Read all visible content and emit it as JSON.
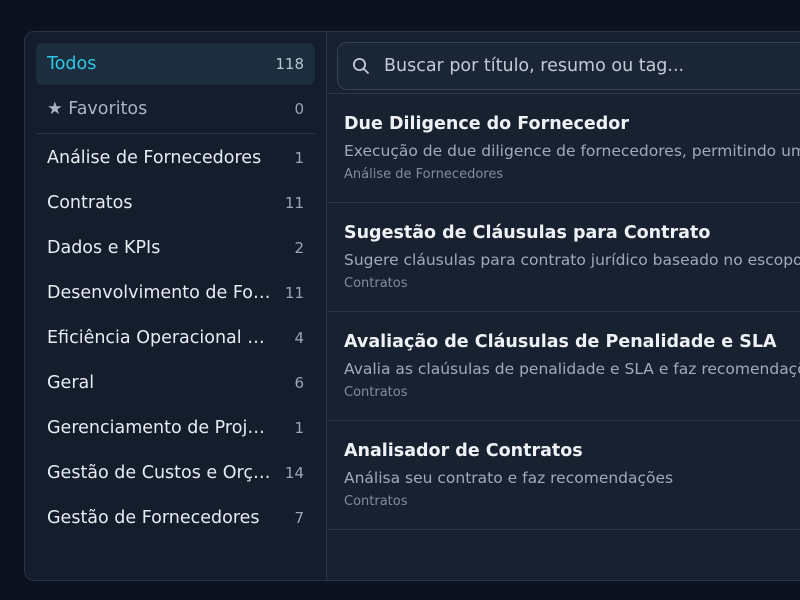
{
  "sidebar": {
    "all": {
      "label": "Todos",
      "count": "118"
    },
    "favorites": {
      "label": "★ Favoritos",
      "count": "0"
    },
    "categories": [
      {
        "label": "Análise de Fornecedores",
        "count": "1"
      },
      {
        "label": "Contratos",
        "count": "11"
      },
      {
        "label": "Dados e KPIs",
        "count": "2"
      },
      {
        "label": "Desenvolvimento de Fornecedores",
        "count": "11"
      },
      {
        "label": "Eficiência Operacional de Compras",
        "count": "4"
      },
      {
        "label": "Geral",
        "count": "6"
      },
      {
        "label": "Gerenciamento de Projetos",
        "count": "1"
      },
      {
        "label": "Gestão de Custos e Orçamento",
        "count": "14"
      },
      {
        "label": "Gestão de Fornecedores",
        "count": "7"
      }
    ]
  },
  "search": {
    "placeholder": "Buscar por título, resumo ou tag..."
  },
  "items": [
    {
      "title": "Due Diligence do Fornecedor",
      "description": "Execução de due diligence de fornecedores, permitindo uma análise",
      "tag": "Análise de Fornecedores"
    },
    {
      "title": "Sugestão de Cláusulas para Contrato",
      "description": "Sugere cláusulas para contrato jurídico baseado no escopo contratado",
      "tag": "Contratos"
    },
    {
      "title": "Avaliação de Cláusulas de Penalidade e SLA",
      "description": "Avalia as claúsulas de penalidade e SLA e faz recomendações",
      "tag": "Contratos"
    },
    {
      "title": "Analisador de Contratos",
      "description": "Análisa seu contrato e faz recomendações",
      "tag": "Contratos"
    }
  ],
  "colors": {
    "accent": "#2fc8e6",
    "background": "#0c1220",
    "panel": "#172130"
  }
}
